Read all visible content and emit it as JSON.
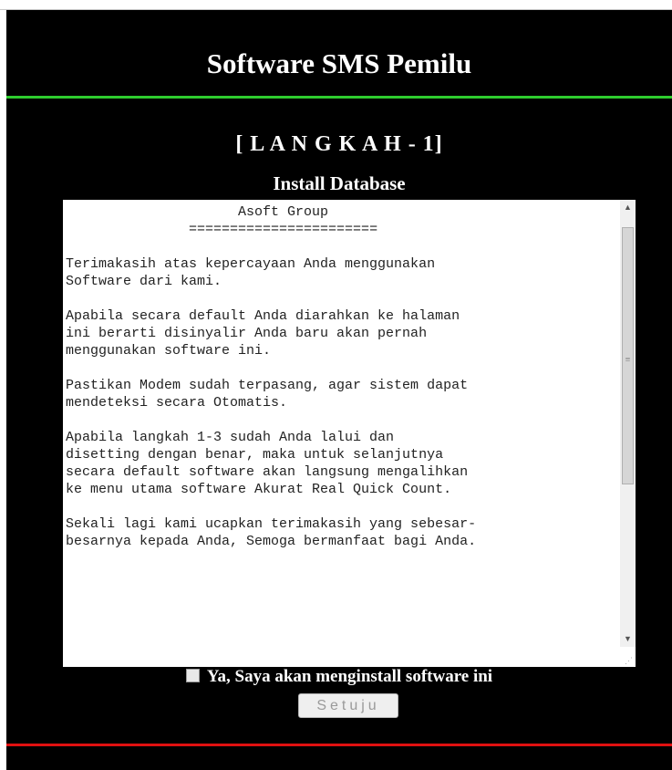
{
  "header": {
    "title": "Software SMS Pemilu"
  },
  "step": {
    "label": "[ L A N G K A H - 1]",
    "subtitle": "Install Database"
  },
  "license_text": "                     Asoft Group\n               =======================\n\nTerimakasih atas kepercayaan Anda menggunakan\nSoftware dari kami.\n\nApabila secara default Anda diarahkan ke halaman\nini berarti disinyalir Anda baru akan pernah\nmenggunakan software ini.\n\nPastikan Modem sudah terpasang, agar sistem dapat\nmendeteksi secara Otomatis.\n\nApabila langkah 1-3 sudah Anda lalui dan\ndisetting dengan benar, maka untuk selanjutnya\nsecara default software akan langsung mengalihkan\nke menu utama software Akurat Real Quick Count.\n\nSekali lagi kami ucapkan terimakasih yang sebesar-\nbesarnya kepada Anda, Semoga bermanfaat bagi Anda.",
  "agree": {
    "label": "Ya, Saya akan menginstall software ini",
    "checked": false
  },
  "button": {
    "label": "Setuju"
  },
  "colors": {
    "background": "#000000",
    "top_rule": "#2ecc2e",
    "bottom_rule": "#e01010",
    "text": "#ffffff"
  }
}
